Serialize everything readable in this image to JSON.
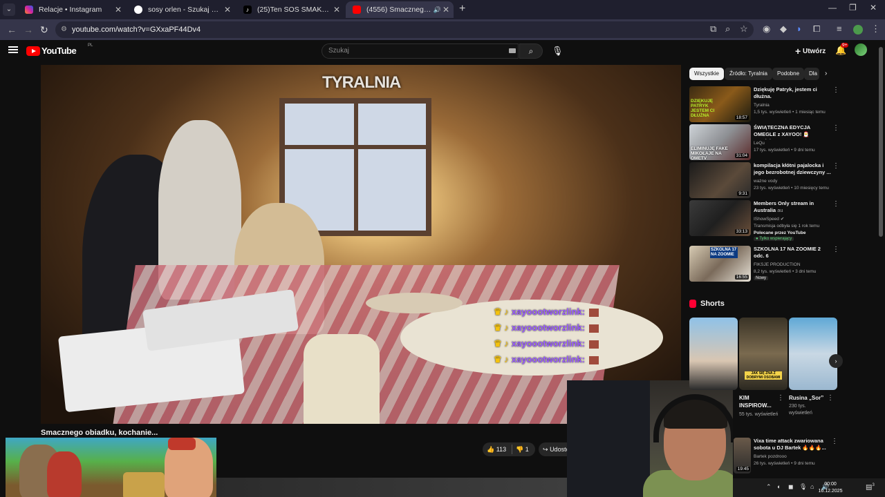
{
  "browser": {
    "tabs": [
      {
        "label": "Relacje • Instagram",
        "favicon_color": "#d6249f"
      },
      {
        "label": "sosy orlen - Szukaj w Google",
        "favicon_color": "#ffffff"
      },
      {
        "label": "(25)Ten SOS SMAKUJE jak KENT",
        "favicon_color": "#000000"
      },
      {
        "label": "(4556) Smacznego obiadku",
        "favicon_color": "#ff0000"
      }
    ],
    "new_tab": "+",
    "url": "youtube.com/watch?v=GXxaPF44Dv4"
  },
  "youtube": {
    "logo_text": "YouTube",
    "country_code": "PL",
    "search_placeholder": "Szukaj",
    "create_label": "Utwórz",
    "notifications_badge": "9+"
  },
  "player": {
    "watermark": "TYRALNIA",
    "chat_messages": [
      "xayoootworzlink:",
      "xayoootworzlink:",
      "xayoootworzlink:",
      "xayoootworzlink:"
    ]
  },
  "video": {
    "title": "Smacznego obiadku, kochanie...",
    "likes": "113",
    "dislikes": "1",
    "share_label": "Udostę"
  },
  "sidebar": {
    "chips": [
      "Wszystkie",
      "Źródło: Tyralnia",
      "Podobne",
      "Dla"
    ],
    "recommendations": [
      {
        "title": "Dziękuję Patryk, jestem ci dłużna.",
        "channel": "Tyralnia",
        "stats": "1,5 tys. wyświetleń • 1 miesiąc temu",
        "duration": "18:57",
        "thumb_text": "DZIĘKUJĘ PATRYK JESTEM CI DŁUŻNA"
      },
      {
        "title": "ŚWIĄTECZNA EDYCJA OMEGLE z XAYOO! 🎅 *rozdajemy ...",
        "channel": "LeQu",
        "stats": "17 tys. wyświetleń • 9 dni temu",
        "duration": "31:04",
        "thumb_text": "ELIMINUJĘ FAKE MIKOŁAJE NA OMETV"
      },
      {
        "title": "kompilacja kłótni pajalocka i jego bezrobotnej dziewczyny ...",
        "channel": "ważne vody",
        "stats": "23 tys. wyświetleń • 10 miesięcy temu",
        "duration": "9:31",
        "thumb_text": ""
      },
      {
        "title": "Members Only stream in Australia",
        "title_suffix": "au",
        "channel": "IShowSpeed",
        "stats": "Transmisja odbyła się 1 rok temu",
        "promo": "Polecane przez YouTube",
        "tag": "Tylko wspierający",
        "duration": "33:13",
        "thumb_text": ""
      },
      {
        "title": "SZKOLNA 17 NA ZOOMIE 2 odc. 6",
        "channel": "FIKSJE PRODUCTION",
        "stats": "8,2 tys. wyświetleń • 3 dni temu",
        "tag": "Nowy",
        "duration": "16:55",
        "thumb_text": "SZKOLNA 17 NA ZOOMIE"
      }
    ],
    "shorts_title": "Shorts",
    "shorts": [
      {
        "title": "KIM INSPIROW...",
        "views": "55 tys. wyświetleń"
      },
      {
        "title": "",
        "views": ""
      },
      {
        "title": "Rusina „Sor”",
        "views": "230 tys. wyświetleń"
      }
    ],
    "short_overlay_text": "JAK SIĘ ZNA Z DOBRYMI OSOBAMI",
    "extra_rec": {
      "title": "Vixa time attack zwariowana sobota u DJ Bartek 🔥🔥🔥...",
      "channel": "Bartek pozdrooo",
      "stats": "26 tys. wyświetleń • 9 dni temu",
      "duration": "19:45"
    }
  },
  "taskbar": {
    "time": "00:00",
    "date": "16.12.2025",
    "notifications": "3"
  }
}
